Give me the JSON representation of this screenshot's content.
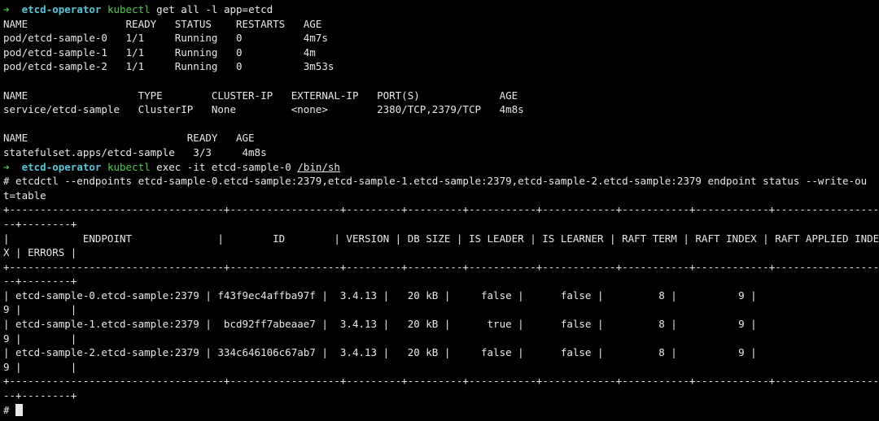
{
  "theme": {
    "background": "#000000",
    "foreground": "#e8e8e8",
    "prompt_arrow_color": "#4ec94e",
    "prompt_dir_color": "#54c7d9",
    "command_name_color": "#4ec94e"
  },
  "prompt1": {
    "arrow": "➜",
    "dir": "etcd-operator",
    "cmd": "kubectl",
    "args": " get all -l app=etcd"
  },
  "pods": {
    "header": "NAME                READY   STATUS    RESTARTS   AGE",
    "rows": [
      "pod/etcd-sample-0   1/1     Running   0          4m7s",
      "pod/etcd-sample-1   1/1     Running   0          4m",
      "pod/etcd-sample-2   1/1     Running   0          3m53s"
    ]
  },
  "services": {
    "header": "NAME                  TYPE        CLUSTER-IP   EXTERNAL-IP   PORT(S)             AGE",
    "rows": [
      "service/etcd-sample   ClusterIP   None         <none>        2380/TCP,2379/TCP   4m8s"
    ]
  },
  "statefulsets": {
    "header": "NAME                          READY   AGE",
    "rows": [
      "statefulset.apps/etcd-sample   3/3     4m8s"
    ]
  },
  "prompt2": {
    "arrow": "➜",
    "dir": "etcd-operator",
    "cmd": "kubectl",
    "args_pre": " exec -it etcd-sample-0 ",
    "path": "/bin/sh"
  },
  "etcdctl": {
    "command_line_1": "# etcdctl --endpoints etcd-sample-0.etcd-sample:2379,etcd-sample-1.etcd-sample:2379,etcd-sample-2.etcd-sample:2379 endpoint status --write-ou",
    "command_line_2": "t=table"
  },
  "table": {
    "border_a": "+-----------------------------------+------------------+---------+---------+-----------+------------+-----------+------------+------------------",
    "border_b": "--+--------+",
    "header_a": "|            ENDPOINT              |        ID        | VERSION | DB SIZE | IS LEADER | IS LEARNER | RAFT TERM | RAFT INDEX | RAFT APPLIED INDE",
    "header_b": "X | ERRORS |",
    "rows": [
      {
        "a": "| etcd-sample-0.etcd-sample:2379 | f43f9ec4affba97f |  3.4.13 |   20 kB |     false |      false |         8 |          9 |",
        "b": "9 |        |"
      },
      {
        "a": "| etcd-sample-1.etcd-sample:2379 |  bcd92ff7abeaae7 |  3.4.13 |   20 kB |      true |      false |         8 |          9 |",
        "b": "9 |        |"
      },
      {
        "a": "| etcd-sample-2.etcd-sample:2379 | 334c646106c67ab7 |  3.4.13 |   20 kB |     false |      false |         8 |          9 |",
        "b": "9 |        |"
      }
    ]
  },
  "final_prompt": {
    "symbol": "# "
  }
}
